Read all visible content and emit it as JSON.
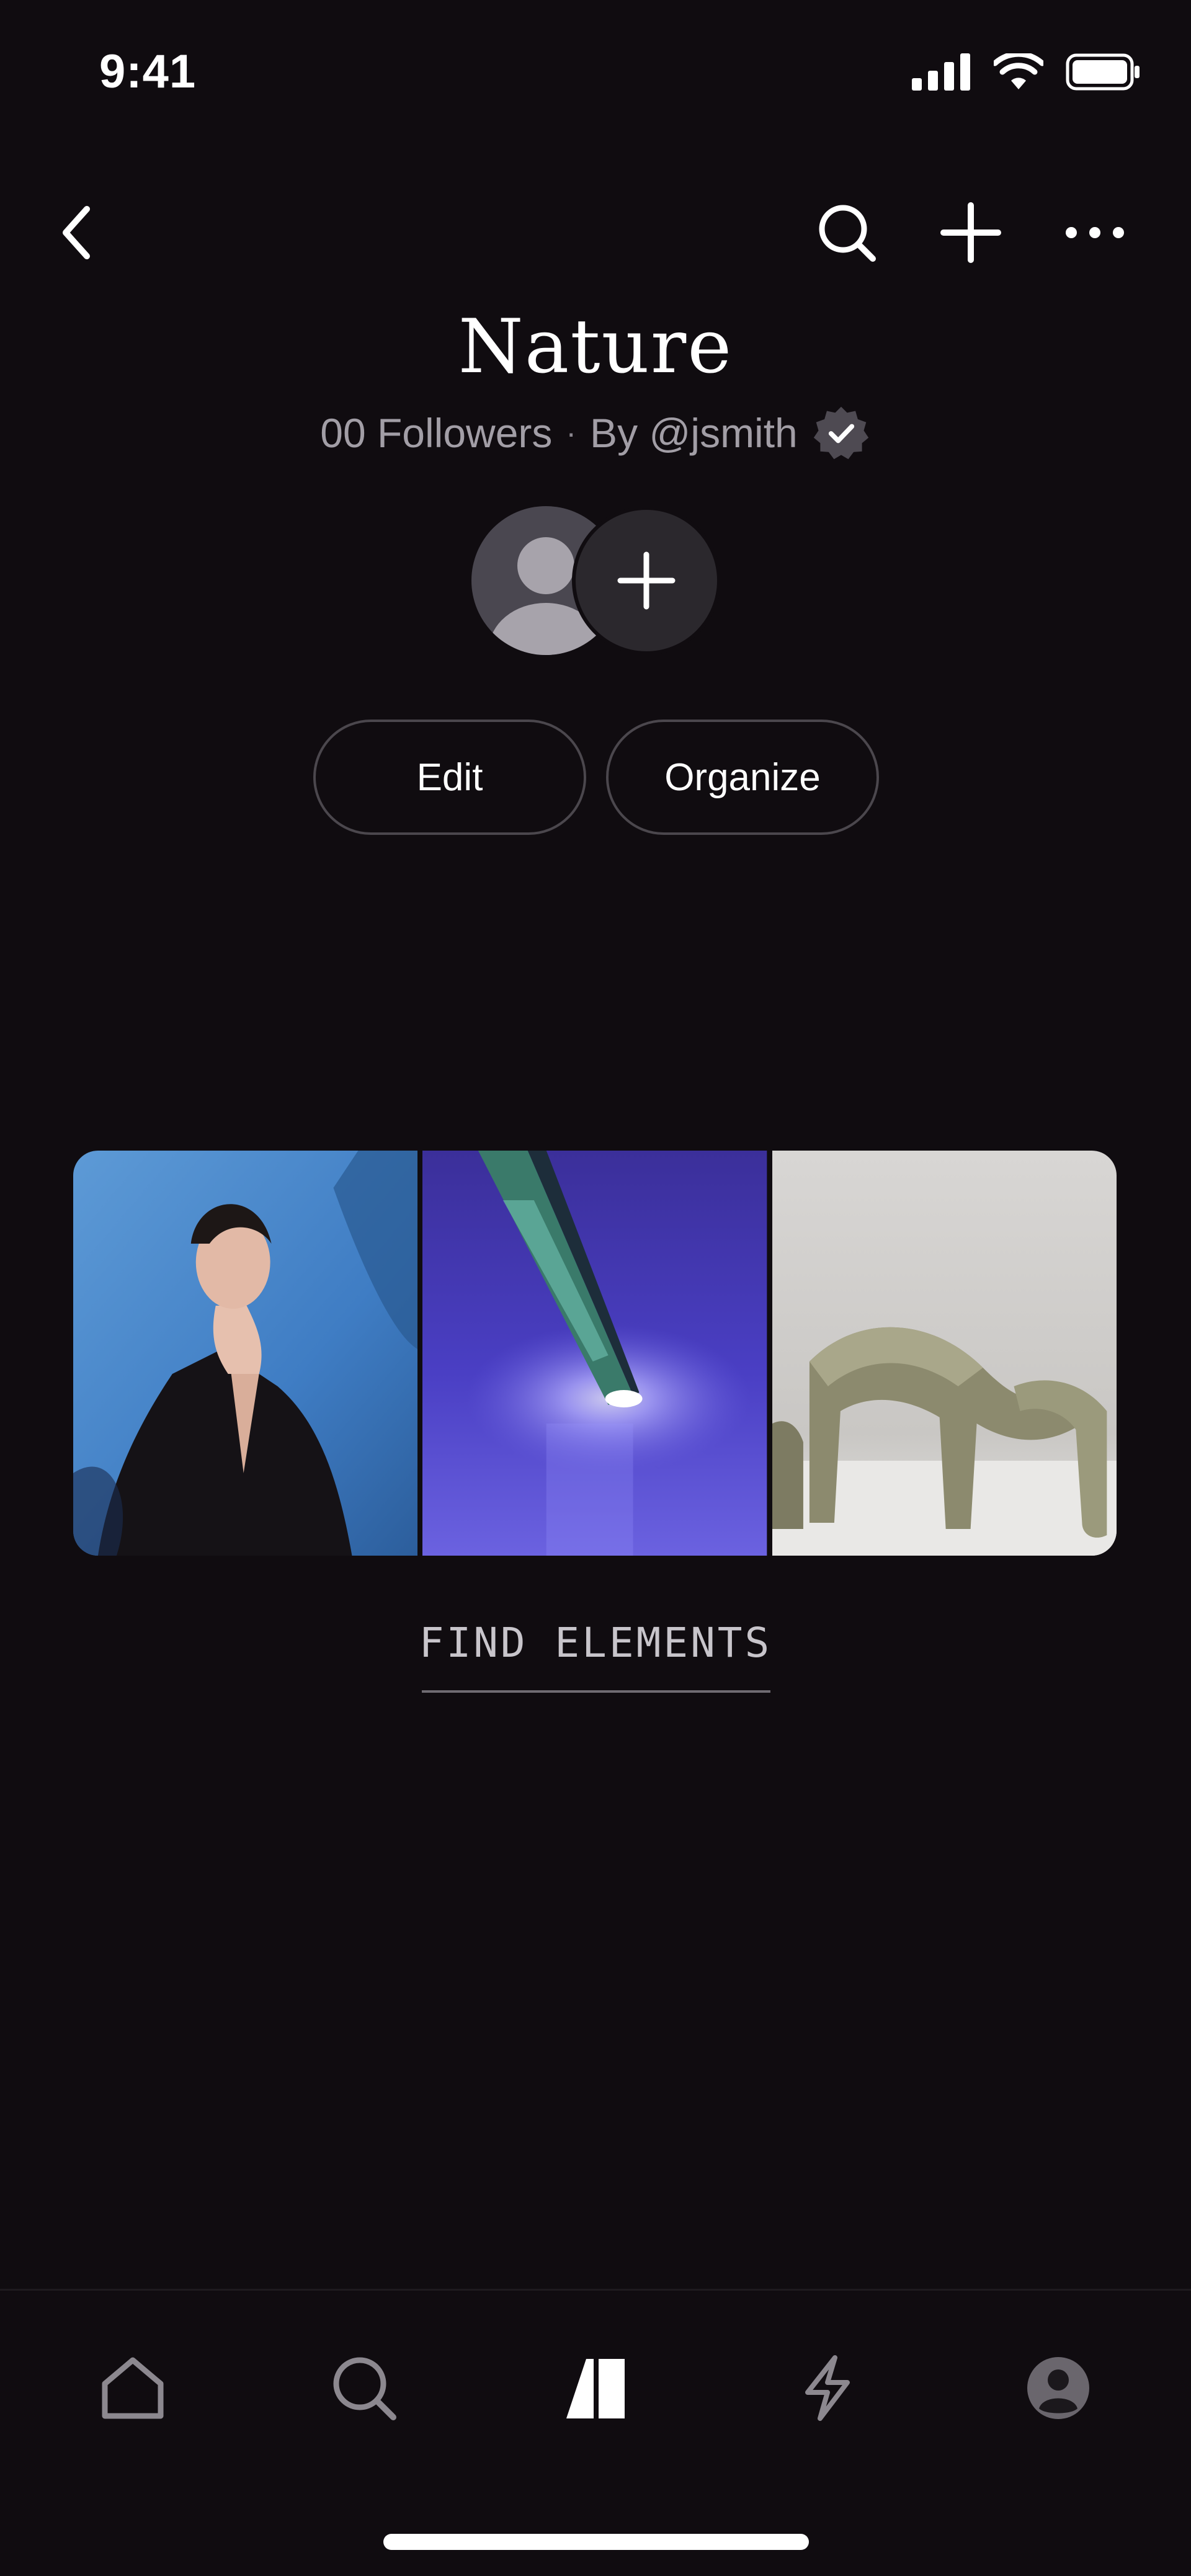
{
  "status_bar": {
    "time": "9:41",
    "icons": [
      "cellular-signal-icon",
      "wifi-icon",
      "battery-icon"
    ]
  },
  "nav": {
    "icons": [
      "back-chevron-icon",
      "search-icon",
      "plus-icon",
      "more-icon"
    ]
  },
  "board": {
    "title": "Nature",
    "followers": "00 Followers",
    "separator": "·",
    "author": "By @jsmith"
  },
  "actions": {
    "edit_label": "Edit",
    "organize_label": "Organize"
  },
  "gallery": {
    "tile_count": 3
  },
  "find_link": "FIND ELEMENTS",
  "tab_bar": {
    "items": [
      "home-tab-icon",
      "search-tab-icon",
      "boards-tab-icon",
      "activity-tab-icon",
      "profile-tab-icon"
    ],
    "active": "boards-tab-icon"
  },
  "colors": {
    "background": "#100c10",
    "text_primary": "#ffffff",
    "text_secondary": "#a29ea6",
    "pill_border": "#4b474d"
  }
}
